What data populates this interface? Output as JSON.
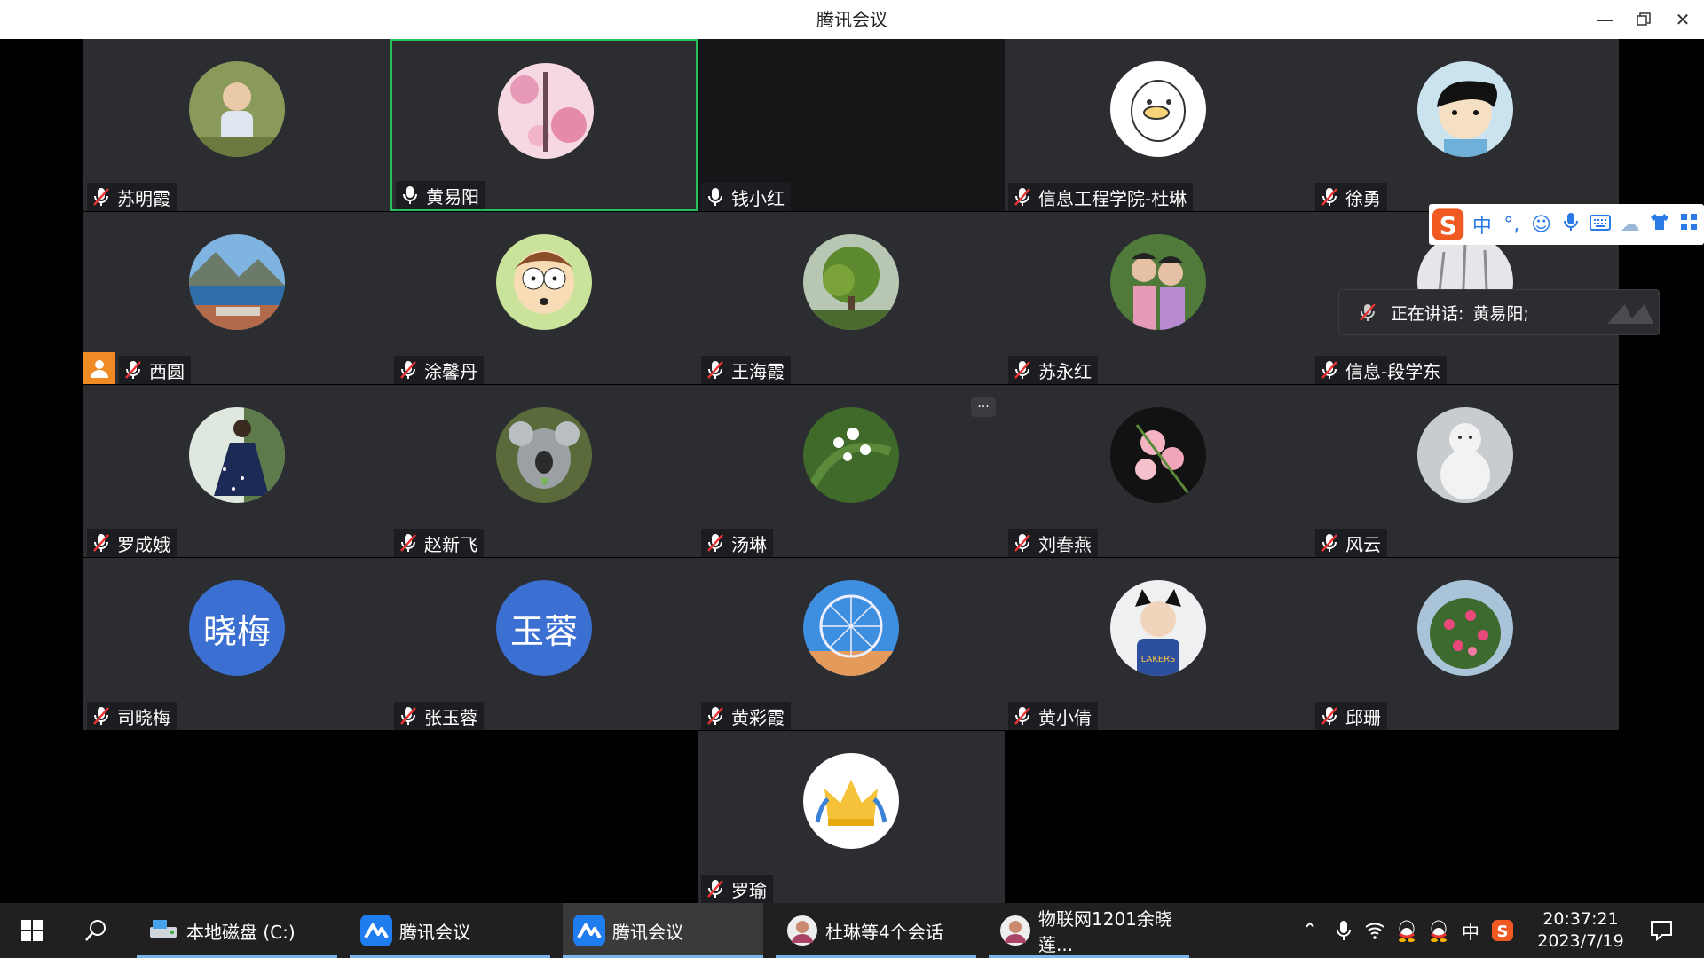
{
  "window": {
    "title": "腾讯会议"
  },
  "participants": [
    {
      "name": "苏明霞",
      "mic": "muted",
      "avatar": "photo-child-icon"
    },
    {
      "name": "黄易阳",
      "mic": "on",
      "avatar": "photo-flowers-girl-icon",
      "active": true
    },
    {
      "name": "钱小红",
      "mic": "on",
      "avatar": "none"
    },
    {
      "name": "信息工程学院-杜琳",
      "mic": "muted",
      "avatar": "duck-cartoon-icon"
    },
    {
      "name": "徐勇",
      "mic": "muted",
      "avatar": "cartoon-boy-icon"
    },
    {
      "name": "西圆",
      "mic": "muted",
      "avatar": "photo-lake-town-icon",
      "host": true
    },
    {
      "name": "涂馨丹",
      "mic": "muted",
      "avatar": "cartoon-morty-icon"
    },
    {
      "name": "王海霞",
      "mic": "muted",
      "avatar": "photo-tree-icon"
    },
    {
      "name": "苏永红",
      "mic": "muted",
      "avatar": "photo-two-people-icon"
    },
    {
      "name": "信息-段学东",
      "mic": "muted",
      "avatar": "photo-snow-trees-icon"
    },
    {
      "name": "罗成娥",
      "mic": "muted",
      "avatar": "photo-woman-dress-icon"
    },
    {
      "name": "赵新飞",
      "mic": "muted",
      "avatar": "photo-koala-icon"
    },
    {
      "name": "汤琳",
      "mic": "muted",
      "avatar": "photo-white-flowers-icon",
      "more": "···"
    },
    {
      "name": "刘春燕",
      "mic": "muted",
      "avatar": "photo-orchid-icon"
    },
    {
      "name": "风云",
      "mic": "muted",
      "avatar": "photo-snowman-icon"
    },
    {
      "name": "司晓梅",
      "mic": "muted",
      "avatar_text": "晓梅"
    },
    {
      "name": "张玉蓉",
      "mic": "muted",
      "avatar_text": "玉蓉"
    },
    {
      "name": "黄彩霞",
      "mic": "muted",
      "avatar": "photo-ferris-wheel-icon"
    },
    {
      "name": "黄小倩",
      "mic": "muted",
      "avatar": "photo-boy-cat-ears-icon"
    },
    {
      "name": "邱珊",
      "mic": "muted",
      "avatar": "photo-pink-flowers-icon"
    },
    {
      "name": "罗瑜",
      "mic": "muted",
      "avatar": "crown-icon"
    }
  ],
  "speaking_panel": {
    "label": "正在讲话:",
    "names": "黄易阳;"
  },
  "ime_toolbar": {
    "mode": "中",
    "punct": "°,"
  },
  "taskbar": {
    "apps": [
      {
        "label": "本地磁盘 (C:)",
        "icon": "drive-icon"
      },
      {
        "label": "腾讯会议",
        "icon": "tencent-meeting-icon"
      },
      {
        "label": "腾讯会议",
        "icon": "tencent-meeting-icon",
        "active": true
      },
      {
        "label": "杜琳等4个会话",
        "icon": "chat-avatar-icon"
      },
      {
        "label": "物联网1201余晓莲...",
        "icon": "chat-avatar-icon"
      }
    ],
    "tray_lang": "中",
    "time": "20:37:21",
    "date": "2023/7/19"
  },
  "colors": {
    "tile": "#2b2d31",
    "active_border": "#24c05a",
    "host_badge": "#f08a24",
    "text_avatar": "#3b6fd1"
  }
}
